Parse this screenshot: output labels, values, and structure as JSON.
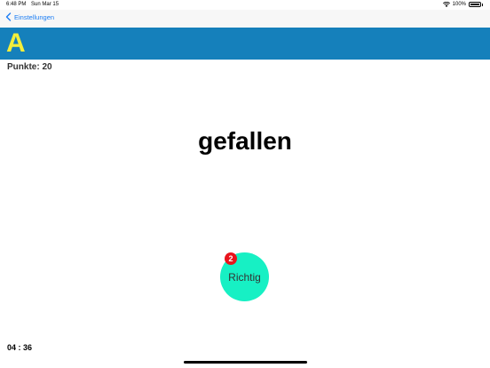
{
  "status_bar": {
    "time": "6:48 PM",
    "date": "Sun Mar 15",
    "battery": "100%"
  },
  "nav": {
    "back_label": "Einstellungen"
  },
  "banner": {
    "letter": "A"
  },
  "score": {
    "label": "Punkte: 20"
  },
  "word": "gefallen",
  "answer_button": {
    "label": "Richtig",
    "badge": "2"
  },
  "timer": "04 : 36",
  "colors": {
    "banner": "#1580bb",
    "letter": "#f3ee3b",
    "answer_button": "#17f0c4",
    "badge": "#e8141c",
    "link": "#1a7cf3"
  }
}
